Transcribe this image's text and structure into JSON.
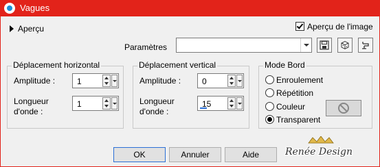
{
  "window": {
    "title": "Vagues"
  },
  "preview": {
    "toggle_label": "Aperçu",
    "checkbox_label": "Aperçu de l'image",
    "checked": true
  },
  "parameters": {
    "label": "Paramètres",
    "value": ""
  },
  "horizontal": {
    "title": "Déplacement horizontal",
    "amplitude_label": "Amplitude :",
    "amplitude_value": "1",
    "wavelength_label_line1": "Longueur",
    "wavelength_label_line2": "d'onde :",
    "wavelength_value": "1"
  },
  "vertical": {
    "title": "Déplacement vertical",
    "amplitude_label": "Amplitude :",
    "amplitude_value": "0",
    "wavelength_label_line1": "Longueur",
    "wavelength_label_line2": "d'onde :",
    "wavelength_value": "15"
  },
  "edge_mode": {
    "title": "Mode Bord",
    "options": [
      "Enroulement",
      "Répétition",
      "Couleur",
      "Transparent"
    ],
    "selected": "Transparent"
  },
  "buttons": {
    "ok": "OK",
    "cancel": "Annuler",
    "help": "Aide"
  },
  "watermark": {
    "text": "Renée Design"
  },
  "icons": [
    "app-icon",
    "save-preset-icon",
    "random-dice-icon",
    "reset-icon",
    "no-color-icon"
  ],
  "colors": {
    "titlebar": "#e2231a",
    "accent": "#2a6fd6"
  }
}
